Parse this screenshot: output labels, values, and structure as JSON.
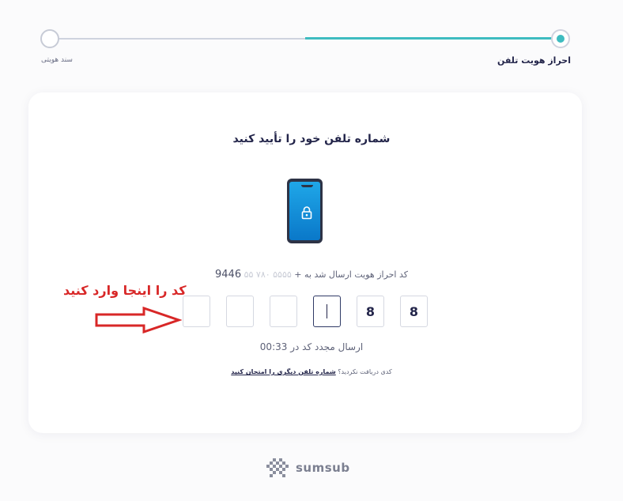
{
  "stepper": {
    "step_left_label": "سند هویتی",
    "step_right_label": "احراز هویت تلفن",
    "progress_color": "#3ebcc0"
  },
  "card": {
    "title": "شماره تلفن خود را تأیید کنید",
    "sent_text_prefix": "کد احراز هویت ارسال شد به",
    "phone_prefix": "+",
    "phone_masked": "۵۵ ۷۸۰ ۵۵۵۵",
    "phone_last": "9446",
    "code_digits": [
      "8",
      "8",
      "",
      "",
      "",
      ""
    ],
    "resend_label": "ارسال مجدد کد در",
    "resend_timer": "00:33",
    "help_text": "کدی دریافت نکردید؟",
    "help_link": "شماره تلفن دیگری را امتحان کنید"
  },
  "annotation": {
    "text": "کد را اینجا وارد کنید",
    "color": "#d82727"
  },
  "brand": {
    "name": "sumsub"
  },
  "icons": {
    "phone": "phone-lock-icon",
    "lock": "lock-icon",
    "brand": "sumsub-logo-icon"
  }
}
